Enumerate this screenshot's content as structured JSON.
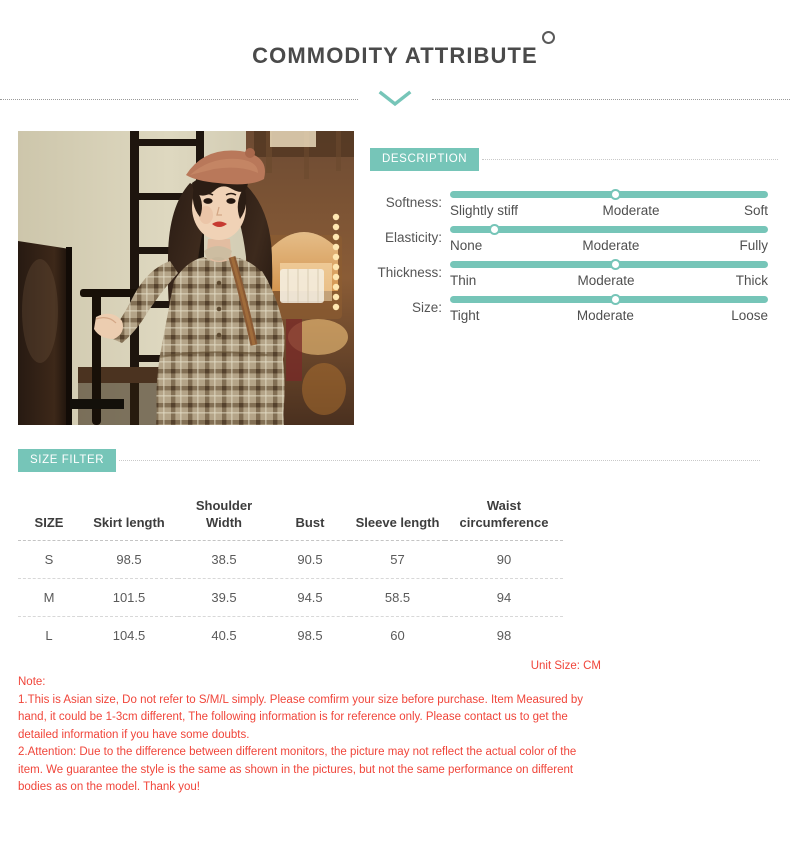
{
  "header": {
    "title": "COMMODITY ATTRIBUTE",
    "superscript_icon": "circle-degree-icon",
    "chevron_icon": "chevron-down-icon"
  },
  "theme": {
    "accent": "#76c5b8",
    "note_red": "#f0453a",
    "title_gray": "#4a4a4a"
  },
  "product_photo": {
    "alt": "Model wearing brown plaid long-sleeve dress with beret and crossbody bag"
  },
  "description": {
    "badge": "DESCRIPTION",
    "sliders": [
      {
        "label": "Softness:",
        "value_percent": 52,
        "scale": [
          "Slightly stiff",
          "Moderate",
          "Soft"
        ]
      },
      {
        "label": "Elasticity:",
        "value_percent": 14,
        "scale": [
          "None",
          "Moderate",
          "Fully"
        ]
      },
      {
        "label": "Thickness:",
        "value_percent": 52,
        "scale": [
          "Thin",
          "Moderate",
          "Thick"
        ]
      },
      {
        "label": "Size:",
        "value_percent": 52,
        "scale": [
          "Tight",
          "Moderate",
          "Loose"
        ]
      }
    ]
  },
  "size_filter": {
    "badge": "SIZE FILTER",
    "columns": [
      "SIZE",
      "Skirt length",
      "Shoulder Width",
      "Bust",
      "Sleeve length",
      "Waist circumference"
    ],
    "rows": [
      [
        "S",
        "98.5",
        "38.5",
        "90.5",
        "57",
        "90"
      ],
      [
        "M",
        "101.5",
        "39.5",
        "94.5",
        "58.5",
        "94"
      ],
      [
        "L",
        "104.5",
        "40.5",
        "98.5",
        "60",
        "98"
      ]
    ],
    "unit_size": "Unit Size: CM"
  },
  "notes": {
    "heading": "Note:",
    "line1": "1.This is Asian size, Do not refer to S/M/L simply. Please comfirm your size before purchase. Item Measured by hand, it could be 1-3cm different, The following information is for reference only. Please contact us to get the detailed information if you have some doubts.",
    "line2": "2.Attention: Due to the difference between different monitors, the picture may not reflect the actual color of the item. We guarantee the style is the same as shown in the pictures, but not the same performance on different bodies as on the model. Thank you!"
  }
}
